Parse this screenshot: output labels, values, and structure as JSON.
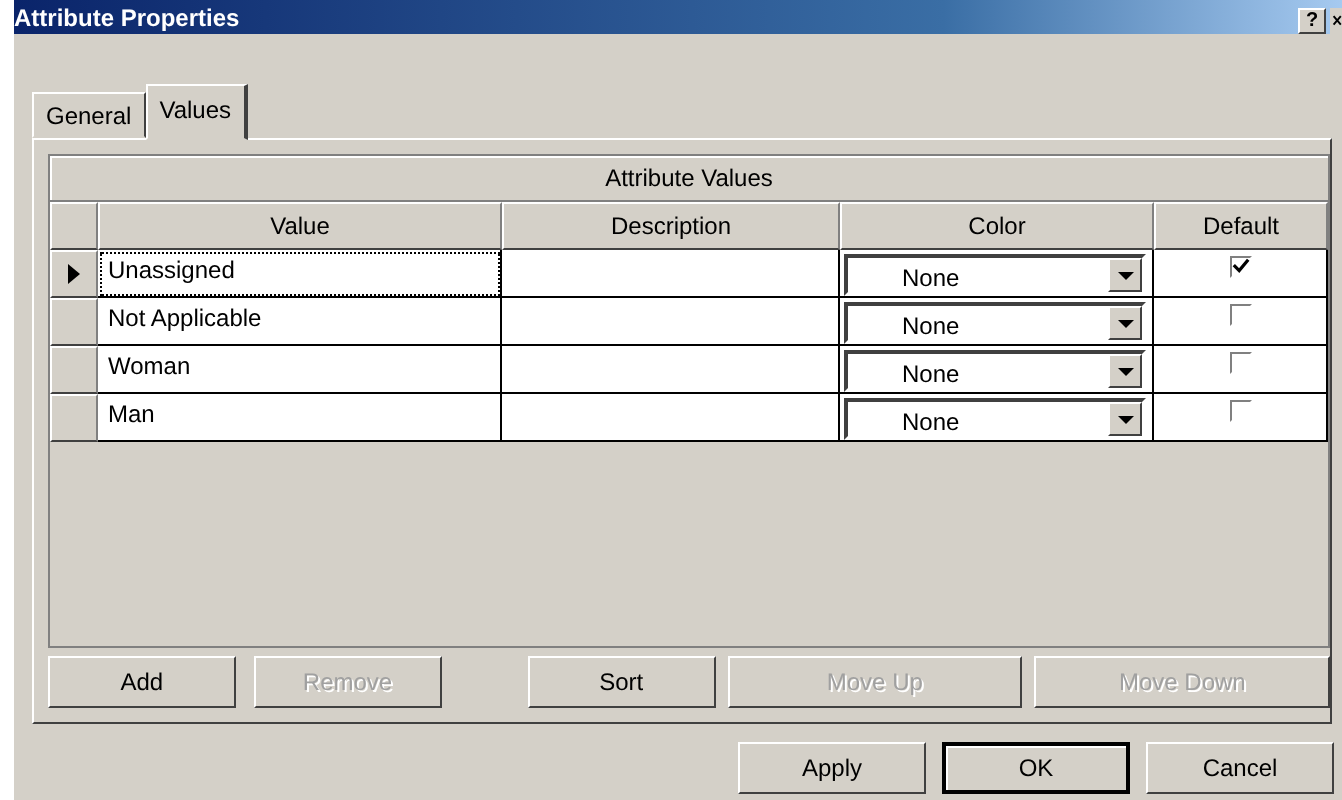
{
  "window": {
    "title": "Attribute Properties",
    "help": "?"
  },
  "tabs": [
    {
      "label": "General",
      "selected": false
    },
    {
      "label": "Values",
      "selected": true
    }
  ],
  "grid": {
    "caption": "Attribute Values",
    "columns": [
      "Value",
      "Description",
      "Color",
      "Default"
    ],
    "rows": [
      {
        "value": "Unassigned",
        "color_name": "None",
        "default": true,
        "current": true
      },
      {
        "value": "Not Applicable",
        "color_name": "None",
        "default": false,
        "current": false
      },
      {
        "value": "Woman",
        "color_name": "None",
        "default": false,
        "current": false
      },
      {
        "value": "Man",
        "color_name": "None",
        "default": false,
        "current": false
      }
    ]
  },
  "grid_buttons": [
    {
      "label": "Add",
      "disabled": false
    },
    {
      "label": "Remove",
      "disabled": true
    },
    {
      "label": "Sort",
      "disabled": false
    },
    {
      "label": "Move Up",
      "disabled": true
    },
    {
      "label": "Move Down",
      "disabled": true
    }
  ],
  "dialog_buttons": [
    {
      "label": "Apply",
      "default": false
    },
    {
      "label": "OK",
      "default": true
    },
    {
      "label": "Cancel",
      "default": false
    }
  ]
}
